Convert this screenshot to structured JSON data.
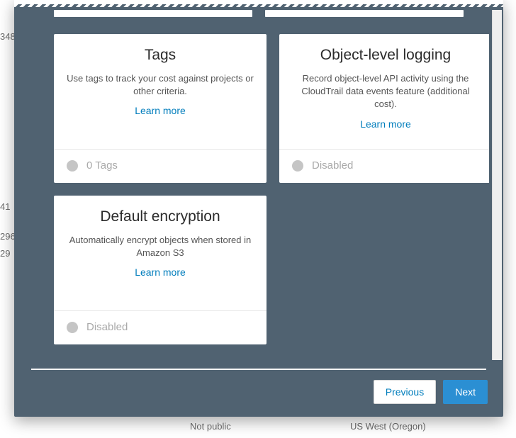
{
  "bg": {
    "row1": "348",
    "row2": "41",
    "row3": "296",
    "row4": "29",
    "row5a": "Not public",
    "row5b": "US West (Oregon)"
  },
  "cards": [
    {
      "title": "Tags",
      "desc": "Use tags to track your cost against projects or other criteria.",
      "learn": "Learn more",
      "status": "0 Tags"
    },
    {
      "title": "Object-level logging",
      "desc": "Record object-level API activity using the CloudTrail data events feature (additional cost).",
      "learn": "Learn more",
      "status": "Disabled"
    },
    {
      "title": "Default encryption",
      "desc": "Automatically encrypt objects when stored in Amazon S3",
      "learn": "Learn more",
      "status": "Disabled"
    }
  ],
  "footer": {
    "previous": "Previous",
    "next": "Next"
  }
}
